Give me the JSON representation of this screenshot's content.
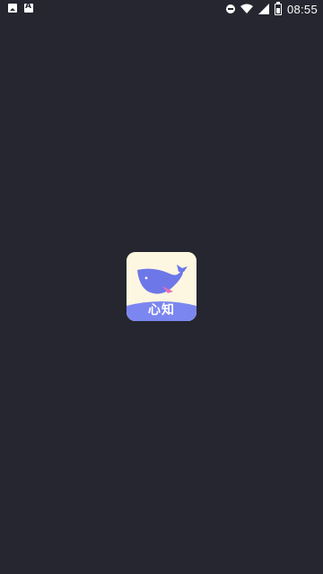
{
  "status_bar": {
    "left_icons": [
      "image-notification-icon",
      "font-notification-icon"
    ],
    "right_icons": [
      "do-not-disturb-icon",
      "wifi-icon",
      "cellular-signal-icon",
      "battery-icon"
    ],
    "time": "08:55"
  },
  "splash": {
    "app_name": "心知",
    "background_color": "#25262f",
    "logo_colors": {
      "background": "#fdf6e1",
      "whale": "#6d77e8",
      "band": "#7c86f0"
    }
  }
}
